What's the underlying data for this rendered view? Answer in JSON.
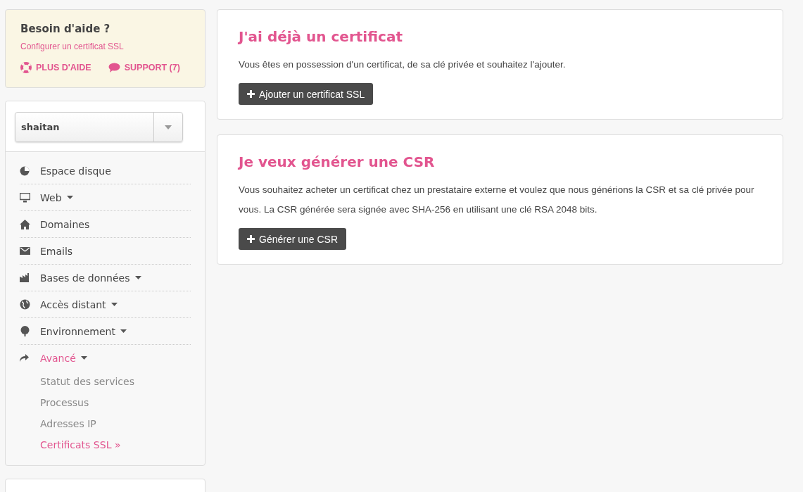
{
  "help": {
    "title": "Besoin d'aide ?",
    "link": "Configurer un certificat SSL",
    "actions": [
      {
        "label": "PLUS D'AIDE"
      },
      {
        "label": "SUPPORT (7)"
      }
    ]
  },
  "account_select": {
    "value": "shaitan"
  },
  "menu": [
    {
      "label": "Espace disque",
      "has_caret": false,
      "selected": false
    },
    {
      "label": "Web",
      "has_caret": true,
      "selected": false
    },
    {
      "label": "Domaines",
      "has_caret": false,
      "selected": false
    },
    {
      "label": "Emails",
      "has_caret": false,
      "selected": false
    },
    {
      "label": "Bases de données",
      "has_caret": true,
      "selected": false
    },
    {
      "label": "Accès distant",
      "has_caret": true,
      "selected": false
    },
    {
      "label": "Environnement",
      "has_caret": true,
      "selected": false
    },
    {
      "label": "Avancé",
      "has_caret": true,
      "selected": true,
      "children": [
        {
          "label": "Statut des services",
          "selected": false
        },
        {
          "label": "Processus",
          "selected": false
        },
        {
          "label": "Adresses IP",
          "selected": false
        },
        {
          "label": "Certificats SSL »",
          "selected": true
        }
      ]
    }
  ],
  "cards": [
    {
      "title": "J'ai déjà un certificat",
      "text": "Vous êtes en possession d'un certificat, de sa clé privée et souhaitez l'ajouter.",
      "button": "Ajouter un certificat SSL"
    },
    {
      "title": "Je veux générer une CSR",
      "text": "Vous souhaitez acheter un certificat chez un prestataire externe et voulez que nous générions la CSR et sa clé privée pour vous. La CSR générée sera signée avec SHA-256 en utilisant une clé RSA 2048 bits.",
      "button": "Générer une CSR"
    }
  ]
}
